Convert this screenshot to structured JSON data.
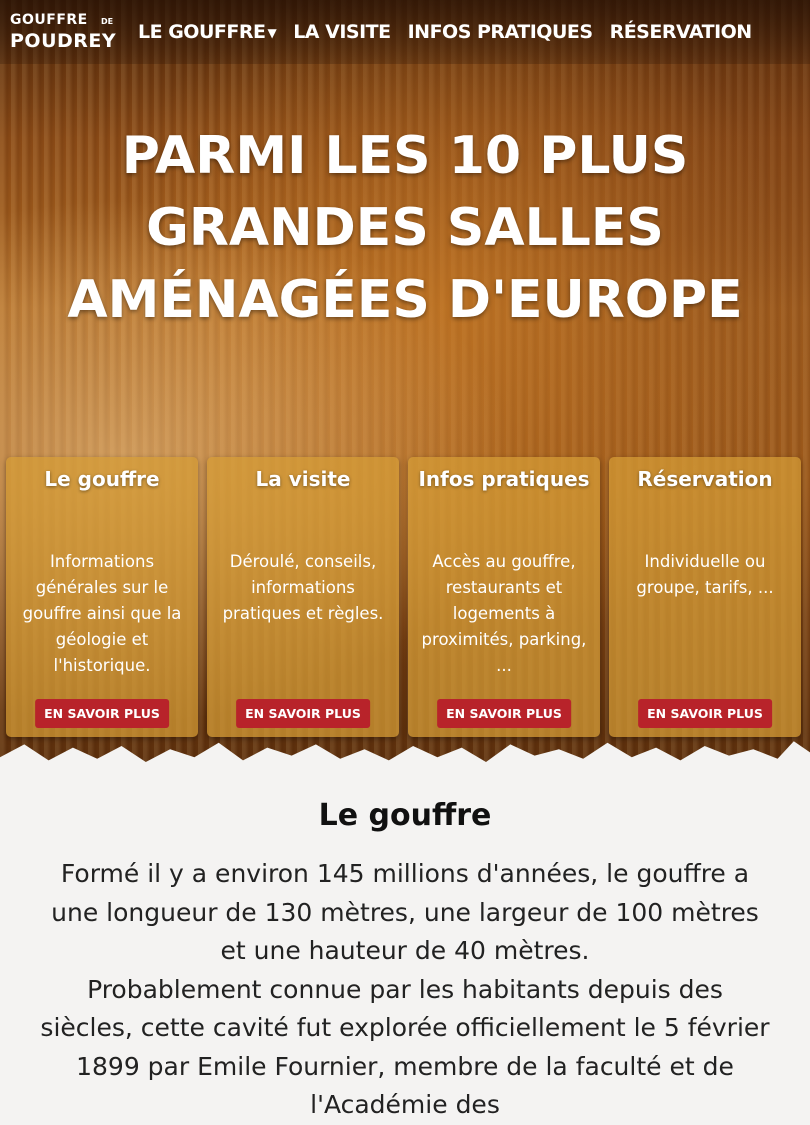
{
  "logo": {
    "line1": "GOUFFRE",
    "de": "DE",
    "line2": "POUDREY"
  },
  "nav": {
    "items": [
      {
        "label": "LE GOUFFRE"
      },
      {
        "label": "LA VISITE"
      },
      {
        "label": "INFOS PRATIQUES"
      },
      {
        "label": "RÉSERVATION"
      }
    ],
    "caret": "▼"
  },
  "hero": {
    "title": "PARMI LES 10 PLUS GRANDES SALLES AMÉNAGÉES D'EUROPE"
  },
  "cards": [
    {
      "title": "Le gouffre",
      "text": "Informations générales sur le gouffre ainsi que la géologie et l'historique.",
      "button": "EN SAVOIR PLUS"
    },
    {
      "title": "La visite",
      "text": "Déroulé, conseils, informations pratiques et règles.",
      "button": "EN SAVOIR PLUS"
    },
    {
      "title": "Infos pratiques",
      "text": "Accès au gouffre, restaurants et logements à proximités, parking, ...",
      "button": "EN SAVOIR PLUS"
    },
    {
      "title": "Réservation",
      "text": "Individuelle ou groupe, tarifs, ...",
      "button": "EN SAVOIR PLUS"
    }
  ],
  "section": {
    "title": "Le gouffre",
    "paragraph1": "Formé il y a environ 145 millions d'années, le gouffre a une longueur de 130 mètres, une largeur de 100 mètres et une hauteur de 40 mètres.",
    "paragraph2": "Probablement connue par les habitants depuis des siècles, cette cavité fut explorée officiellement le 5 février 1899 par Emile Fournier, membre de la faculté et de l'Académie des"
  }
}
